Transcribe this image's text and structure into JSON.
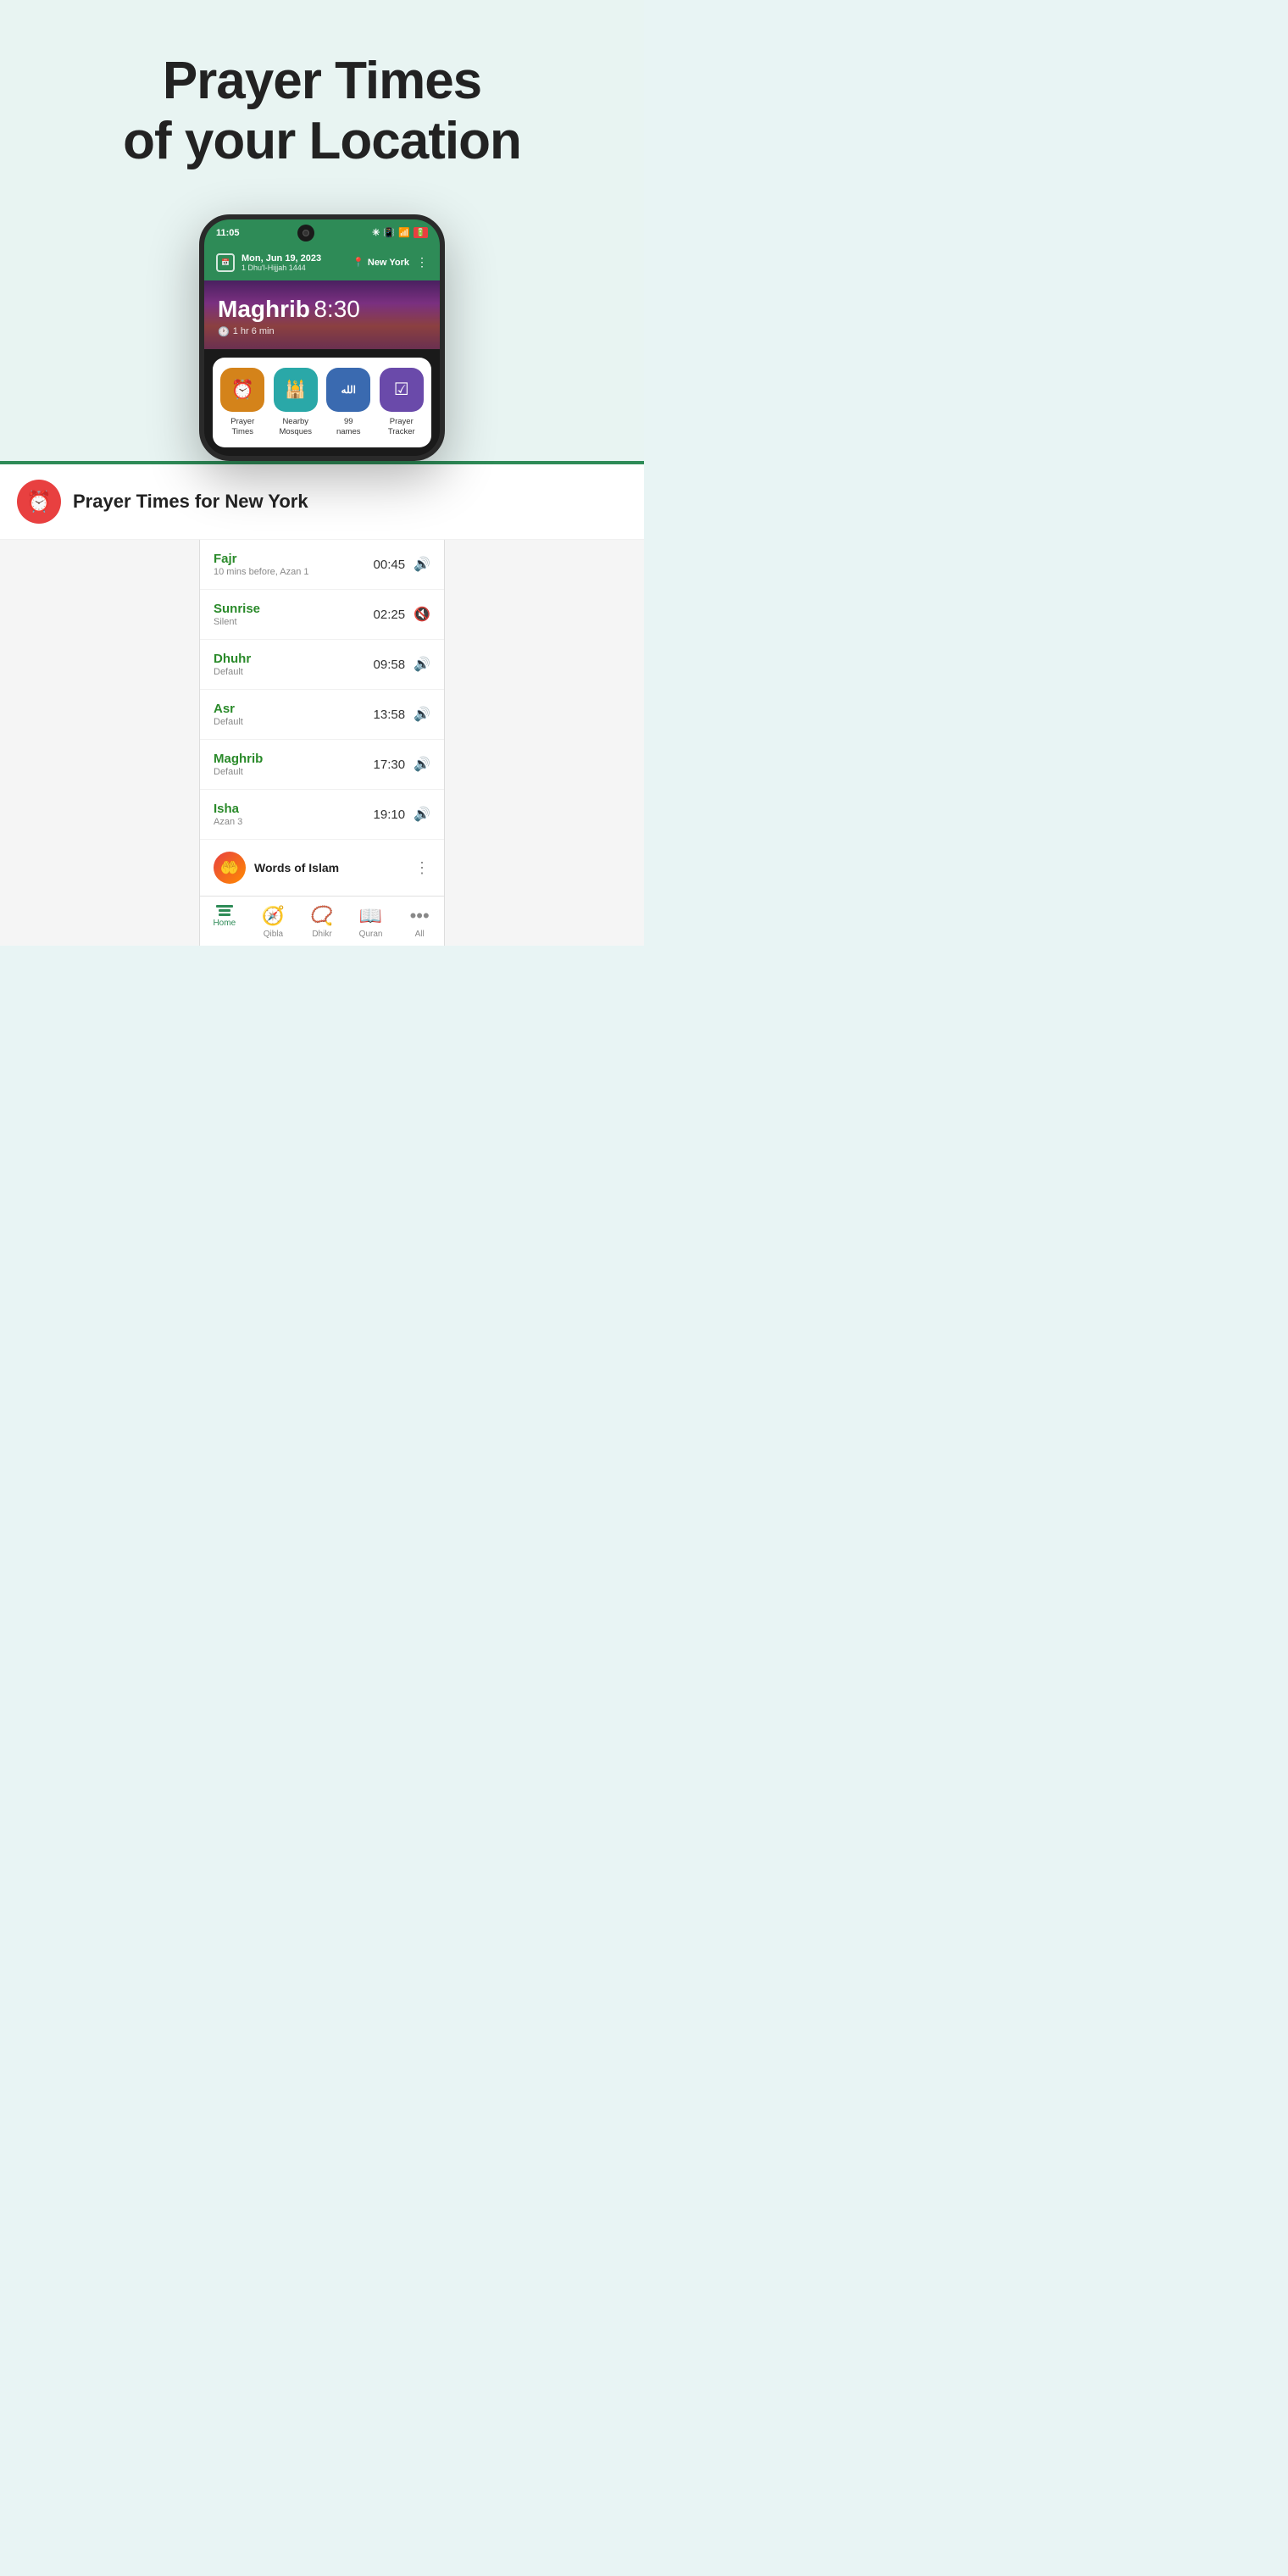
{
  "hero": {
    "title_line1": "Prayer Times",
    "title_line2": "of your Location"
  },
  "phone": {
    "status_time": "11:05",
    "date": "Mon, Jun 19, 2023",
    "hijri": "1 Dhu'l-Hijjah 1444",
    "location": "New York",
    "prayer_name": "Maghrib",
    "prayer_time": "8:30",
    "countdown": "1 hr 6 min",
    "quick_actions": [
      {
        "label": "Prayer\nTimes",
        "icon": "⏰",
        "color_class": "icon-orange"
      },
      {
        "label": "Nearby\nMosques",
        "icon": "🕌",
        "color_class": "icon-teal"
      },
      {
        "label": "99\nnames",
        "icon": "الله",
        "color_class": "icon-blue"
      },
      {
        "label": "Prayer\nTracker",
        "icon": "☑",
        "color_class": "icon-purple"
      }
    ]
  },
  "prayer_times_header": {
    "title": "Prayer Times for New York"
  },
  "prayers": [
    {
      "name": "Fajr",
      "sub": "10 mins before, Azan 1",
      "time": "00:45",
      "sound": true
    },
    {
      "name": "Sunrise",
      "sub": "Silent",
      "time": "02:25",
      "sound": false
    },
    {
      "name": "Dhuhr",
      "sub": "Default",
      "time": "09:58",
      "sound": true
    },
    {
      "name": "Asr",
      "sub": "Default",
      "time": "13:58",
      "sound": true
    },
    {
      "name": "Maghrib",
      "sub": "Default",
      "time": "17:30",
      "sound": true
    },
    {
      "name": "Isha",
      "sub": "Azan 3",
      "time": "19:10",
      "sound": true
    }
  ],
  "words_of_islam": {
    "title": "Words of Islam"
  },
  "bottom_nav": [
    {
      "label": "Home",
      "active": true
    },
    {
      "label": "Qibla",
      "active": false
    },
    {
      "label": "Dhikr",
      "active": false
    },
    {
      "label": "Quran",
      "active": false
    },
    {
      "label": "All",
      "active": false
    }
  ]
}
